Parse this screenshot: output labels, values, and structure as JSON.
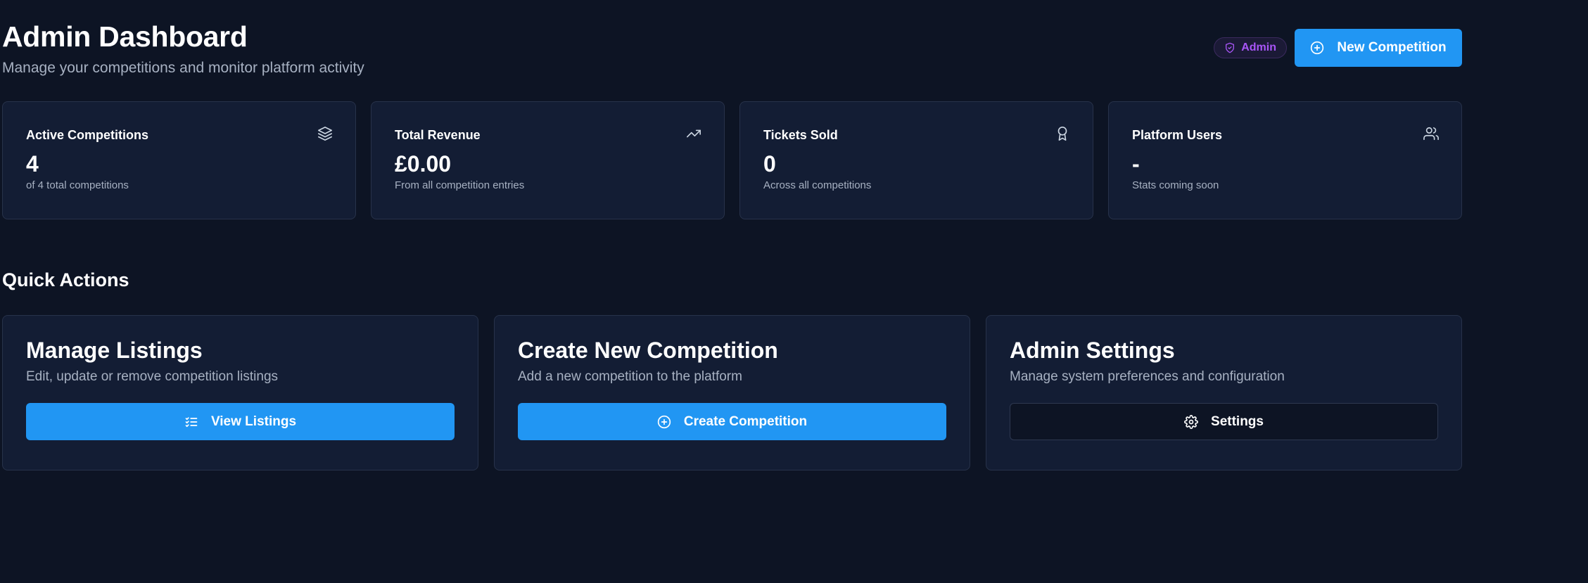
{
  "header": {
    "title": "Admin Dashboard",
    "subtitle": "Manage your competitions and monitor platform activity",
    "badge": "Admin",
    "new_button": "New Competition"
  },
  "stats": [
    {
      "label": "Active Competitions",
      "value": "4",
      "note": "of 4 total competitions",
      "icon": "layers-icon"
    },
    {
      "label": "Total Revenue",
      "value": "£0.00",
      "note": "From all competition entries",
      "icon": "trending-up-icon"
    },
    {
      "label": "Tickets Sold",
      "value": "0",
      "note": "Across all competitions",
      "icon": "award-icon"
    },
    {
      "label": "Platform Users",
      "value": "-",
      "note": "Stats coming soon",
      "icon": "users-icon"
    }
  ],
  "quick_actions": {
    "title": "Quick Actions",
    "cards": [
      {
        "title": "Manage Listings",
        "description": "Edit, update or remove competition listings",
        "button": "View Listings",
        "icon": "list-checks-icon"
      },
      {
        "title": "Create New Competition",
        "description": "Add a new competition to the platform",
        "button": "Create Competition",
        "icon": "plus-circle-icon"
      },
      {
        "title": "Admin Settings",
        "description": "Manage system preferences and configuration",
        "button": "Settings",
        "icon": "gear-icon"
      }
    ]
  },
  "colors": {
    "background": "#0d1424",
    "card": "#131d34",
    "primary": "#2196f3",
    "badge": "#a855f7"
  }
}
